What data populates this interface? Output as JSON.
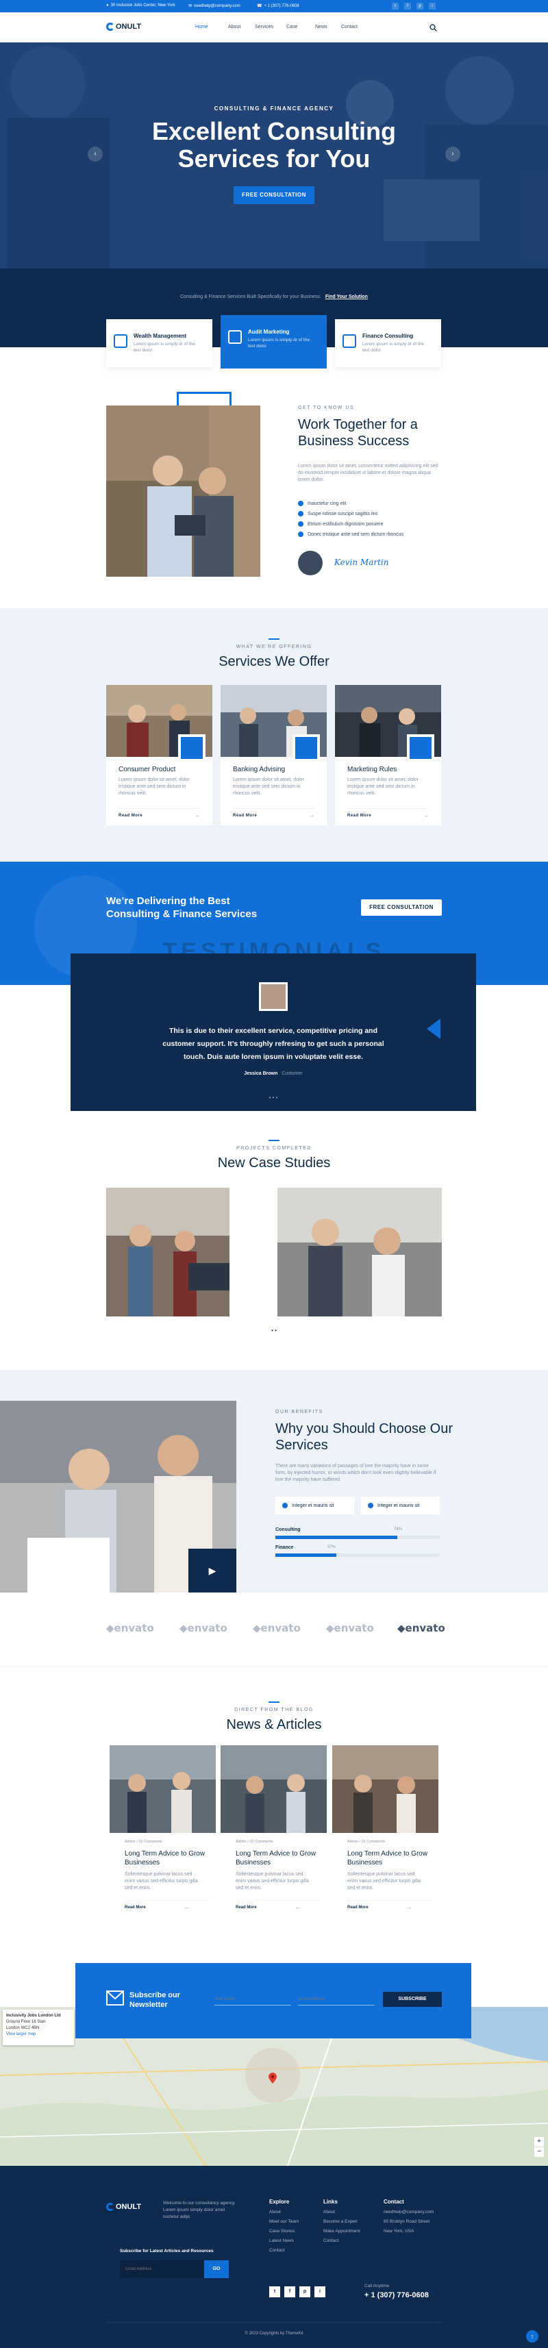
{
  "topbar": {
    "address": "30 Inclusive Jobs Center, New York",
    "email": "needhelp@company.com",
    "phone": "+ 1 (307) 776-0608",
    "social": [
      "t",
      "f",
      "p",
      "i"
    ]
  },
  "header": {
    "logo_text": "ONULT",
    "nav": [
      "Home",
      "About",
      "Services",
      "Case",
      "News",
      "Contact"
    ]
  },
  "hero": {
    "kicker": "Consulting & Finance Agency",
    "title_line1": "Excellent Consulting",
    "title_line2": "Services for You",
    "button": "Free Consultation",
    "prev": "‹",
    "next": "›"
  },
  "band": {
    "tagline": "Consulting & Finance Services Built Specifically for your Business.",
    "link": "Find Your Solution"
  },
  "features": [
    {
      "title": "Wealth Management",
      "desc": "Lorem ipsum is simply dr of the text dolor."
    },
    {
      "title": "Audit Marketing",
      "desc": "Lorem ipsum is simply dr of the text dolor."
    },
    {
      "title": "Finance Consulting",
      "desc": "Lorem ipsum is simply dr of the text dolor."
    }
  ],
  "about": {
    "kicker": "Get to know us",
    "title_line1": "Work Together for a",
    "title_line2": "Business Success",
    "desc": "Lorem ipsum dolor sit amet, consectetur notted adipisicing elit sed do eiusmod tempor incididunt ut labore et dolore magna aliqua lorem dollor.",
    "checks": [
      "Inauctelur cing elit",
      "Suspe ndisse suscipit sagittis leo",
      "Entum estibulum dignissim posuere",
      "Donec tristique ante sed sem dictum rhoncus"
    ],
    "signature": "Kevin Martin"
  },
  "services": {
    "kicker": "What we're offering",
    "title": "Services We Offer",
    "items": [
      {
        "title": "Consumer Product",
        "desc": "Lorem ipsum dolor sit amet, dolor tristique ante sed sem dictum in rhoncus velit.",
        "link": "Read More"
      },
      {
        "title": "Banking Advising",
        "desc": "Lorem ipsum dolor sit amet, dolor tristique ante sed sem dictum in rhoncus velit.",
        "link": "Read More"
      },
      {
        "title": "Marketing Rules",
        "desc": "Lorem ipsum dolor sit amet, dolor tristique ante sed sem dictum in rhoncus velit.",
        "link": "Read More"
      }
    ]
  },
  "cta": {
    "title_line1": "We’re Delivering the Best",
    "title_line2": "Consulting & Finance Services",
    "button": "Free Consultation",
    "watermark": "TESTIMONIALS"
  },
  "testimonial": {
    "text_line1": "This is due to their excellent service, competitive pricing and",
    "text_line2": "customer support. It’s throughly refresing to get such a personal",
    "text_line3": "touch. Duis aute lorem ipsum in voluptate velit esse.",
    "name": "Jessica Brown",
    "role": "Customer",
    "dots": "• • •"
  },
  "cases": {
    "kicker": "Projects Completed",
    "title": "New Case Studies",
    "dots": "• •"
  },
  "why": {
    "kicker": "Our Benefits",
    "title_line1": "Why you Should Choose Our",
    "title_line2": "Services",
    "desc": "There are many variations of passages of lore the majority have in some form, by injected humor, or words which don't look even slightly believable if lore the majority have suffered.",
    "pills": [
      "Integer et mauris sit",
      "Integer et mauris sit"
    ],
    "bars": [
      {
        "label": "Consulting",
        "value": 74,
        "display": "74%"
      },
      {
        "label": "Finance",
        "value": 37,
        "display": "37%"
      }
    ],
    "play": "▶"
  },
  "clients": [
    "envato",
    "envato",
    "envato",
    "envato",
    "envato"
  ],
  "news": {
    "kicker": "Direct from the blog",
    "title": "News & Articles",
    "items": [
      {
        "meta": "Admin  •  02 Comments",
        "title": "Long Term Advice to Grow Businesses",
        "desc": "Sollentesque pulvinar lacus sed enim varius sed efficitur turpis gilla sed et enim.",
        "link": "Read More"
      },
      {
        "meta": "Admin  •  02 Comments",
        "title": "Long Term Advice to Grow Businesses",
        "desc": "Sollentesque pulvinar lacus sed enim varius sed efficitur turpis gilla sed et enim.",
        "link": "Read More"
      },
      {
        "meta": "Admin  •  02 Comments",
        "title": "Long Term Advice to Grow Businesses",
        "desc": "Sollentesque pulvinar lacus sed enim varius sed efficitur turpis gilla sed et enim.",
        "link": "Read More"
      }
    ]
  },
  "newsletter": {
    "title_line1": "Subscribe our",
    "title_line2": "Newsletter",
    "name_placeholder": "Your Name",
    "email_placeholder": "Email Address",
    "button": "Subscribe"
  },
  "map": {
    "card_title": "Inclusivity Jobs London Ltd",
    "card_line1": "Ground Floor 16 Stan",
    "card_line2": "London WC2 4BN",
    "card_link": "View larger map",
    "zoom_in": "+",
    "zoom_out": "−"
  },
  "footer": {
    "logo_text": "ONULT",
    "about": "Welcome to our consultancy agency. Lorem ipsum simply dolor amet nsctetur adipi.",
    "subscribe_title": "Subscribe for Latest Articles and Resources",
    "email_placeholder": "Email Address",
    "go": "GO",
    "explore_title": "Explore",
    "explore": [
      "About",
      "Meet our Team",
      "Case Stories",
      "Latest News",
      "Contact"
    ],
    "links_title": "Links",
    "links": [
      "About",
      "Become a Expert",
      "Make Appointment",
      "Contact"
    ],
    "contact_title": "Contact",
    "contact": [
      "needhelp@company.com",
      "80 Broklyn Road Street",
      "New York, USA"
    ],
    "call_label": "Call Anytime",
    "call_number": "+ 1 (307) 776-0608",
    "social": [
      "t",
      "f",
      "p",
      "i"
    ],
    "copyright": "© 2023 Copyrights by ThemeKit",
    "top": "↑"
  }
}
